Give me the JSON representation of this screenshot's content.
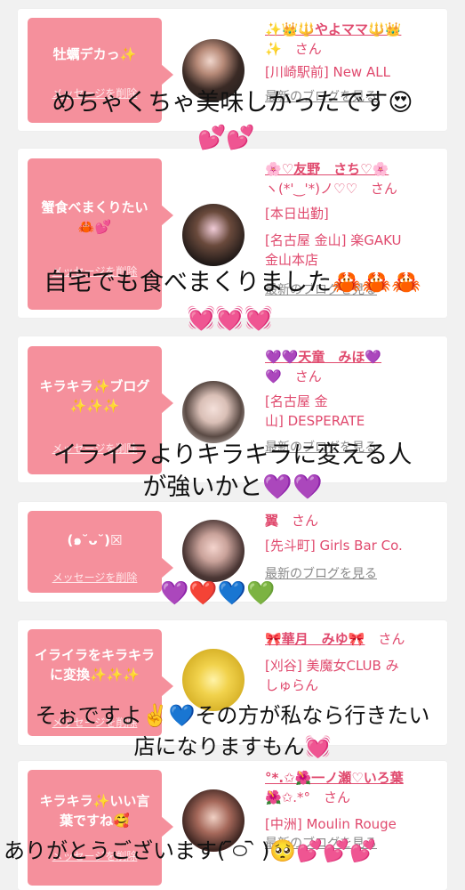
{
  "cards": [
    {
      "bubble_message": "牡蠣デカっ✨",
      "delete_label": "メッセージを削除",
      "name": "✨👑🔱やよママ🔱👑",
      "name_extra": "✨",
      "san": "さん",
      "shop_lines": [
        "[川崎駅前] New ALL"
      ],
      "blog_label": "最新のブログを見る"
    },
    {
      "bubble_message": "蟹食べまくりたい🦀💕",
      "delete_label": "メッセージを削除",
      "name": "🌸♡友野　さち♡🌸",
      "name_extra": "ヽ(*'‿'*)ノ♡♡",
      "san": "さん",
      "shop_lines": [
        "[本日出勤]",
        "[名古屋 金山] 楽GAKU",
        "金山本店"
      ],
      "blog_label": "最新のブログを見る"
    },
    {
      "bubble_message": "キラキラ✨ブログ✨✨✨",
      "delete_label": "メッセージを削除",
      "name": "💜💜天童　みほ💜",
      "name_extra": "💜",
      "san": "さん",
      "shop_lines": [
        "[名古屋 金",
        "山] DESPERATE"
      ],
      "blog_label": "最新のブログを見る"
    },
    {
      "bubble_message": "(๑˘ᴗ˘)☒",
      "delete_label": "メッセージを削除",
      "name": "翼",
      "name_extra": "",
      "san": "さん",
      "shop_lines": [
        "[先斗町] Girls Bar Co."
      ],
      "blog_label": "最新のブログを見る"
    },
    {
      "bubble_message": "イライラをキラキラに変換✨✨✨",
      "delete_label": "メッセージを削除",
      "name": "🎀華月　みゆ🎀",
      "name_extra": "",
      "san": "さん",
      "shop_lines": [
        "[刈谷] 美魔女CLUB み",
        "しゅらん"
      ],
      "blog_label": "最新のブログを見る"
    },
    {
      "bubble_message": "キラキラ✨いい言葉ですね🥰",
      "delete_label": "メッセージを削除",
      "name": "°*.✩🌺一ノ瀬♡いろ葉",
      "name_extra": "🌺✩.*°",
      "san": "さん",
      "shop_lines": [
        "[中洲] Moulin Rouge"
      ],
      "blog_label": "最新のブログを見る"
    }
  ],
  "overlays": [
    "めちゃくちゃ美味しかったです😍",
    "💕💕",
    "自宅でも食べまくりました🦀🦀🦀",
    "💓💓💓",
    "イライラよりキラキラに変える人",
    "が強いかと💜💜",
    "💜❤️💙💚",
    "そぉですよ✌️💙その方が私なら行きたい",
    "店になりますもん💓",
    "ありがとうございます( ᷇࿀ ᷆ )🥺💕💕💕"
  ],
  "colors": {
    "background": "#f1f1f1",
    "bubble": "#f5909c",
    "name_text": "#e04a6e",
    "blog_link": "#8a8a8a"
  }
}
